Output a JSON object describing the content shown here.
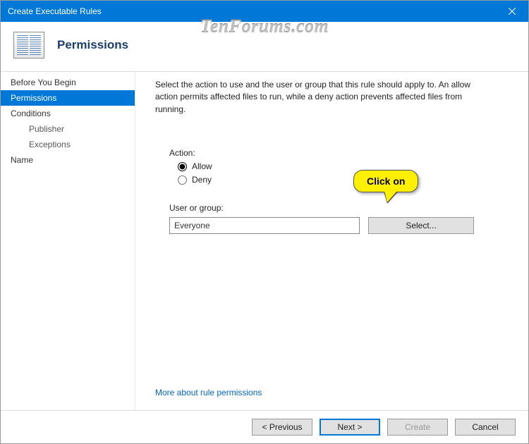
{
  "window": {
    "title": "Create Executable Rules"
  },
  "watermark": "TenForums.com",
  "header": {
    "title": "Permissions"
  },
  "sidebar": {
    "items": [
      {
        "label": "Before You Begin",
        "selected": false,
        "indent": false
      },
      {
        "label": "Permissions",
        "selected": true,
        "indent": false
      },
      {
        "label": "Conditions",
        "selected": false,
        "indent": false
      },
      {
        "label": "Publisher",
        "selected": false,
        "indent": true
      },
      {
        "label": "Exceptions",
        "selected": false,
        "indent": true
      },
      {
        "label": "Name",
        "selected": false,
        "indent": false
      }
    ]
  },
  "content": {
    "intro": "Select the action to use and the user or group that this rule should apply to. An allow action permits affected files to run, while a deny action prevents affected files from running.",
    "action_label": "Action:",
    "allow_label": "Allow",
    "deny_label": "Deny",
    "user_group_label": "User or group:",
    "user_group_value": "Everyone",
    "select_button": "Select...",
    "help_link": "More about rule permissions"
  },
  "footer": {
    "previous": "< Previous",
    "next": "Next >",
    "create": "Create",
    "cancel": "Cancel"
  },
  "callout": {
    "text": "Click on"
  }
}
